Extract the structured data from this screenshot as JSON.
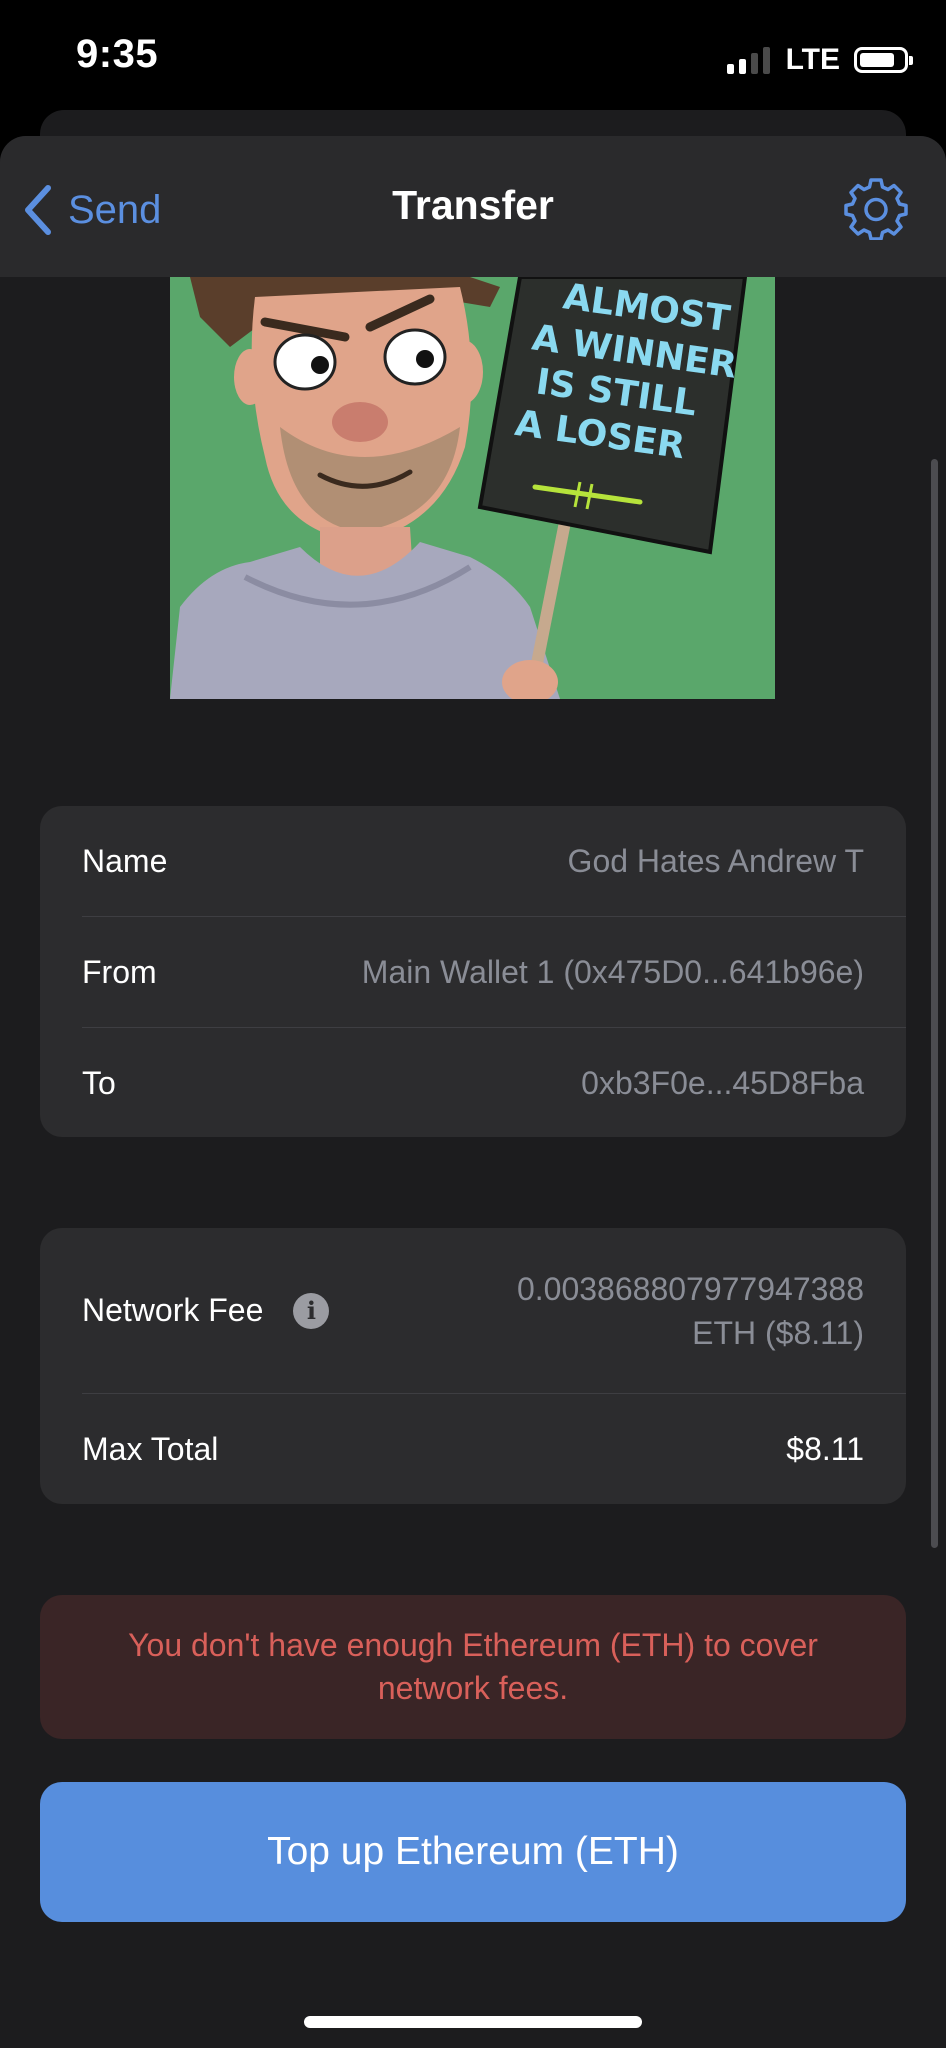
{
  "status_bar": {
    "time": "9:35",
    "network": "LTE",
    "signal_bars_active": 2,
    "signal_bars_total": 4,
    "battery_level": 0.7
  },
  "nav": {
    "back_label": "Send",
    "title": "Transfer",
    "settings_icon": "gear-icon"
  },
  "nft_image": {
    "sign_text": [
      "ALMOST",
      "A WINNER",
      "IS STILL",
      "A LOSER"
    ]
  },
  "details": {
    "name_label": "Name",
    "name_value": "God Hates Andrew T",
    "from_label": "From",
    "from_value": "Main Wallet 1 (0x475D0...641b96e)",
    "to_label": "To",
    "to_value": "0xb3F0e...45D8Fba"
  },
  "fees": {
    "network_fee_label": "Network Fee",
    "network_fee_value_line1": "0.003868807977947388",
    "network_fee_value_line2": "ETH ($8.11)",
    "info_icon": "info-icon",
    "max_total_label": "Max Total",
    "max_total_value": "$8.11"
  },
  "error_message": "You don't have enough Ethereum (ETH) to cover network fees.",
  "cta_label": "Top up Ethereum (ETH)",
  "colors": {
    "accent": "#578edd",
    "link": "#5b8fe0",
    "error_text": "#d9605a",
    "error_bg": "#3a2526",
    "card_bg": "#2c2c2e",
    "sheet_bg": "#1c1c1e",
    "nft_bg": "#5aa76b"
  }
}
